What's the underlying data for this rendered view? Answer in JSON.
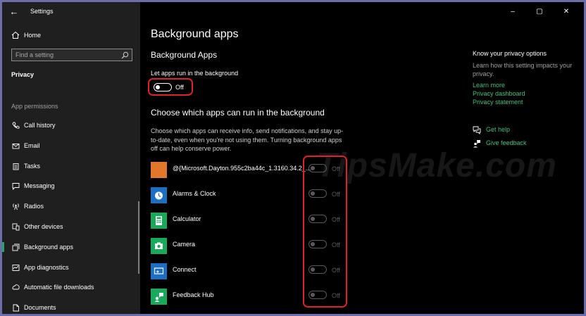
{
  "window": {
    "title": "Settings",
    "controls": [
      "–",
      "▢",
      "✕"
    ]
  },
  "sidebar": {
    "home_label": "Home",
    "search_placeholder": "Find a setting",
    "section": "Privacy",
    "subhead": "App permissions",
    "items": [
      {
        "label": "Call history",
        "icon": "call-history-icon"
      },
      {
        "label": "Email",
        "icon": "email-icon"
      },
      {
        "label": "Tasks",
        "icon": "tasks-icon"
      },
      {
        "label": "Messaging",
        "icon": "messaging-icon"
      },
      {
        "label": "Radios",
        "icon": "radios-icon"
      },
      {
        "label": "Other devices",
        "icon": "other-devices-icon"
      },
      {
        "label": "Background apps",
        "icon": "background-apps-icon",
        "active": true
      },
      {
        "label": "App diagnostics",
        "icon": "app-diagnostics-icon"
      },
      {
        "label": "Automatic file downloads",
        "icon": "file-downloads-icon"
      },
      {
        "label": "Documents",
        "icon": "documents-icon"
      }
    ]
  },
  "main": {
    "title": "Background apps",
    "section_heading": "Background Apps",
    "let_apps_label": "Let apps run in the background",
    "master_toggle": {
      "state": "Off"
    },
    "choose_heading": "Choose which apps can run in the background",
    "description": "Choose which apps can receive info, send notifications, and stay up-to-date, even when you're not using them. Turning background apps off can help conserve power.",
    "apps": [
      {
        "name": "@{Microsoft.Dayton.955c2ba44c_1.3160.34.2_...",
        "state": "Off",
        "tile_color": "#e0772a"
      },
      {
        "name": "Alarms & Clock",
        "state": "Off",
        "tile_color": "#1c6fc2"
      },
      {
        "name": "Calculator",
        "state": "Off",
        "tile_color": "#18a95a"
      },
      {
        "name": "Camera",
        "state": "Off",
        "tile_color": "#18a95a"
      },
      {
        "name": "Connect",
        "state": "Off",
        "tile_color": "#1c6fc2"
      },
      {
        "name": "Feedback Hub",
        "state": "Off",
        "tile_color": "#18a95a"
      }
    ]
  },
  "right": {
    "title": "Know your privacy options",
    "desc": "Learn how this setting impacts your privacy.",
    "links": [
      "Learn more",
      "Privacy dashboard",
      "Privacy statement"
    ],
    "help": "Get help",
    "feedback": "Give feedback"
  },
  "watermark": "TipsMake.com",
  "colors": {
    "accent": "#3ec07b",
    "highlight": "#e0202a",
    "sidebar_bg": "#1f1f1f"
  }
}
